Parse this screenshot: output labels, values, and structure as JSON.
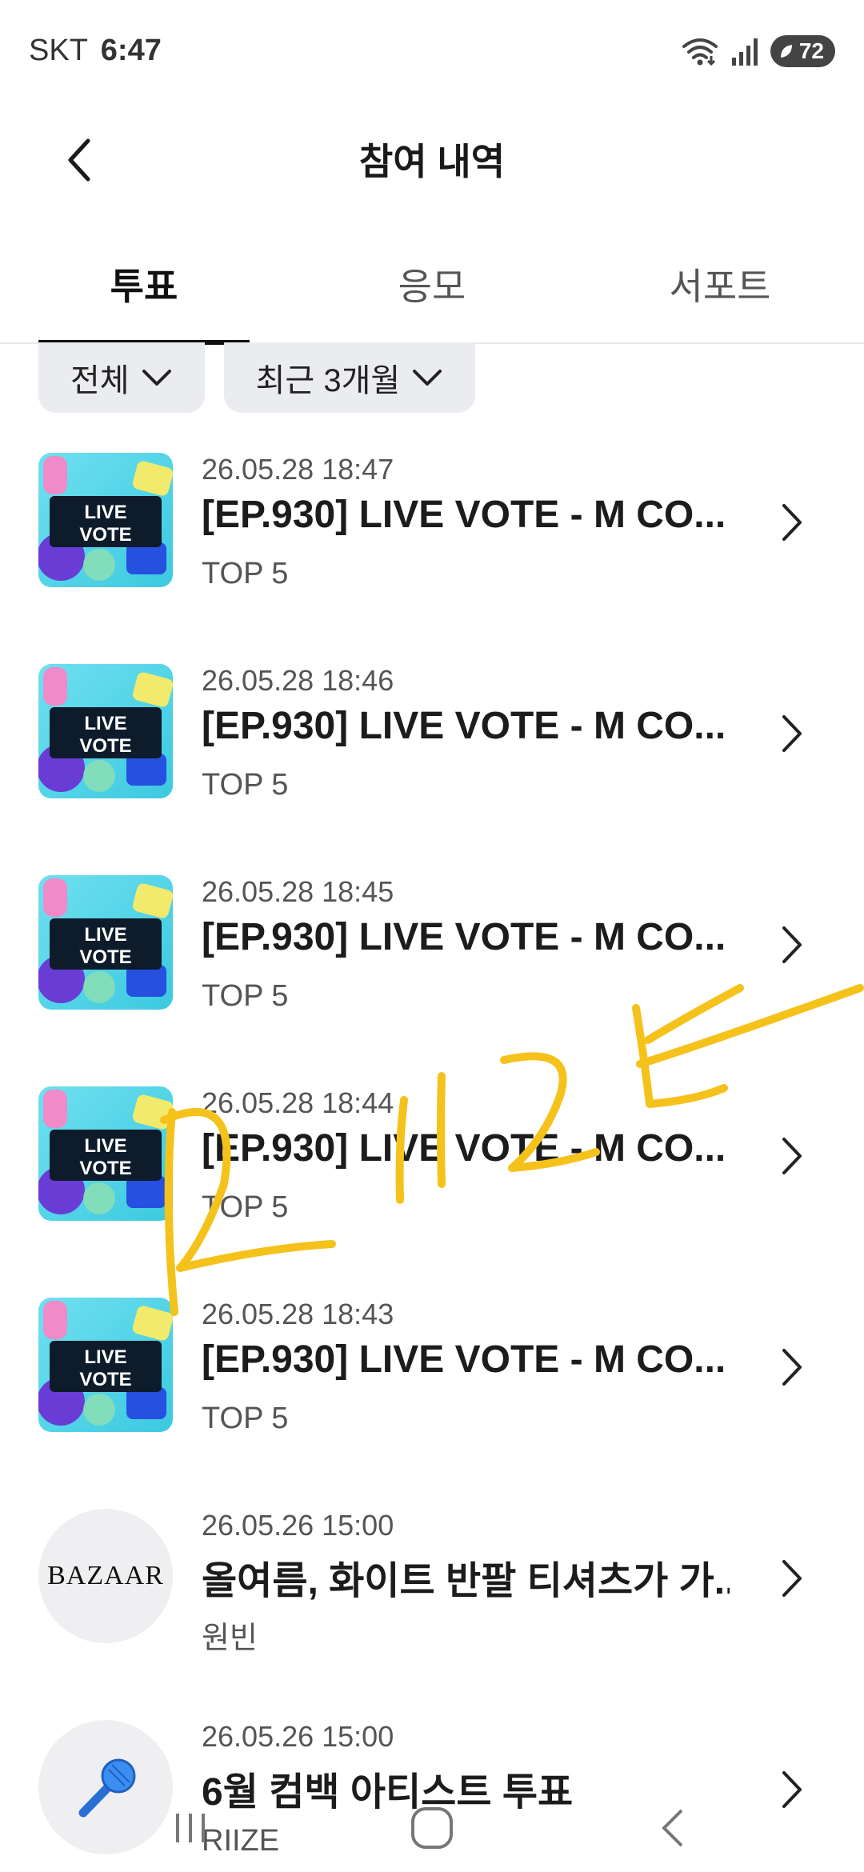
{
  "status_bar": {
    "carrier": "SKT",
    "time": "6:47",
    "battery": "72"
  },
  "header": {
    "title": "참여 내역"
  },
  "tabs": [
    {
      "label": "투표",
      "active": true
    },
    {
      "label": "응모",
      "active": false
    },
    {
      "label": "서포트",
      "active": false
    }
  ],
  "filters": {
    "type": "전체",
    "period": "최근 3개월"
  },
  "items": [
    {
      "date": "26.05.28 18:47",
      "title": "[EP.930] LIVE VOTE - M CO...",
      "sub": "TOP 5",
      "thumb": "live-vote"
    },
    {
      "date": "26.05.28 18:46",
      "title": "[EP.930] LIVE VOTE - M CO...",
      "sub": "TOP 5",
      "thumb": "live-vote"
    },
    {
      "date": "26.05.28 18:45",
      "title": "[EP.930] LIVE VOTE - M CO...",
      "sub": "TOP 5",
      "thumb": "live-vote"
    },
    {
      "date": "26.05.28 18:44",
      "title": "[EP.930] LIVE VOTE - M CO...",
      "sub": "TOP 5",
      "thumb": "live-vote"
    },
    {
      "date": "26.05.28 18:43",
      "title": "[EP.930] LIVE VOTE - M CO...",
      "sub": "TOP 5",
      "thumb": "live-vote"
    },
    {
      "date": "26.05.26 15:00",
      "title": "올여름, 화이트 반팔 티셔츠가 가...",
      "sub": "원빈",
      "thumb": "bazaar"
    },
    {
      "date": "26.05.26 15:00",
      "title": "6월 컴백 아티스트 투표",
      "sub": "RIIZE",
      "thumb": "microphone"
    }
  ],
  "thumb_text": {
    "live": "LIVE",
    "vote": "VOTE",
    "bazaar": "BAZAAR"
  },
  "icons": {
    "back": "chevron-left-icon",
    "dropdown": "chevron-down-icon",
    "row_arrow": "chevron-right-icon",
    "wifi": "wifi-icon",
    "signal": "signal-icon",
    "battery": "battery-icon",
    "nav_recents": "recents-icon",
    "nav_home": "home-icon",
    "nav_back": "back-icon"
  },
  "colors": {
    "scribble": "#f5c21b",
    "tab_active": "#111111",
    "filter_bg": "#ebecef"
  }
}
